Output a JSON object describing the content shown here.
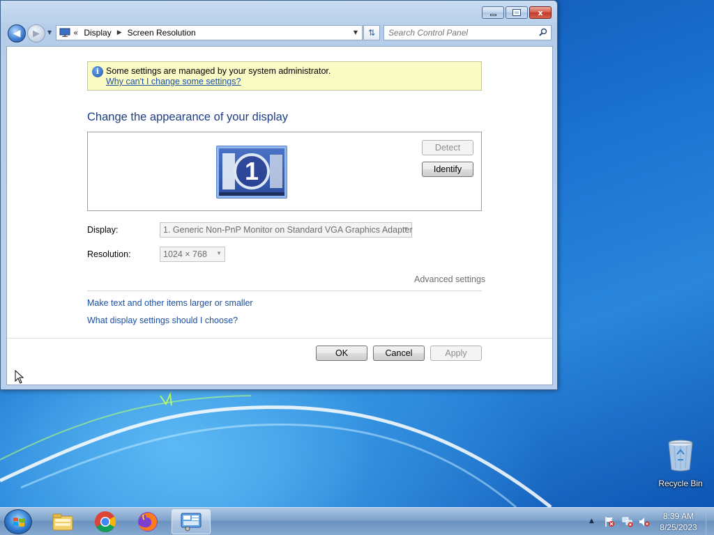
{
  "window": {
    "breadcrumb": [
      "Display",
      "Screen Resolution"
    ],
    "search_placeholder": "Search Control Panel",
    "caption": {
      "minimize": "",
      "maximize": "",
      "close": "x"
    }
  },
  "info_bar": {
    "message": "Some settings are managed by your system administrator.",
    "link": "Why can't I change some settings?"
  },
  "main": {
    "heading": "Change the appearance of your display",
    "monitor_number": "1",
    "detect_label": "Detect",
    "identify_label": "Identify",
    "display_label": "Display:",
    "display_value": "1. Generic Non-PnP Monitor on Standard VGA Graphics Adapter",
    "resolution_label": "Resolution:",
    "resolution_value": "1024 × 768",
    "advanced_label": "Advanced settings",
    "links": [
      "Make text and other items larger or smaller",
      "What display settings should I choose?"
    ],
    "ok_label": "OK",
    "cancel_label": "Cancel",
    "apply_label": "Apply"
  },
  "desktop": {
    "recycle_bin_label": "Recycle Bin"
  },
  "taskbar": {
    "items": [
      "windows-explorer",
      "google-chrome",
      "firefox",
      "control-panel"
    ],
    "time": "8:39 AM",
    "date": "8/25/2023"
  },
  "colors": {
    "link": "#1a4fa3",
    "heading": "#1f3d83",
    "info_bg": "#fbfbc6"
  }
}
